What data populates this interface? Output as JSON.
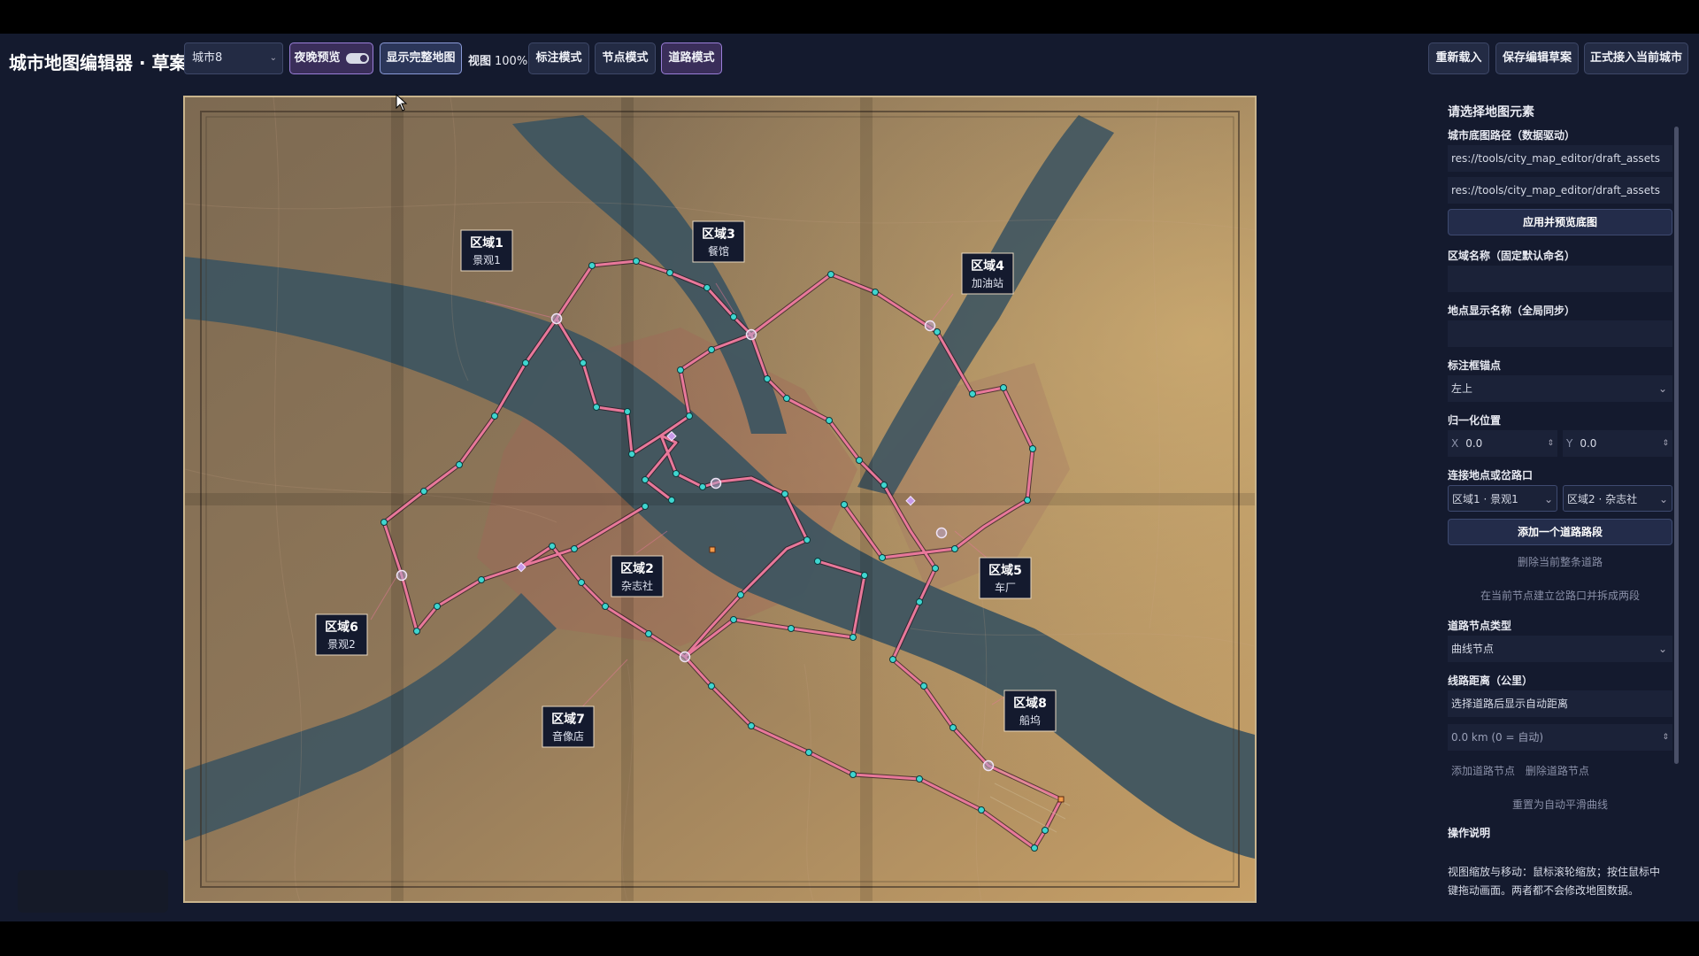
{
  "toolbar": {
    "title": "城市地图编辑器 · 草案",
    "city_select": "城市8",
    "night_preview": "夜晚预览",
    "show_full_map": "显示完整地图",
    "zoom_label": "视图",
    "zoom_value": "100%",
    "label_mode": "标注模式",
    "node_mode": "节点模式",
    "road_mode": "道路模式",
    "reload": "重新载入",
    "save_draft": "保存编辑草案",
    "apply_city": "正式接入当前城市"
  },
  "map": {
    "regions": [
      {
        "title": "区域1",
        "sub": "景观1"
      },
      {
        "title": "区域2",
        "sub": "杂志社"
      },
      {
        "title": "区域3",
        "sub": "餐馆"
      },
      {
        "title": "区域4",
        "sub": "加油站"
      },
      {
        "title": "区域5",
        "sub": "车厂"
      },
      {
        "title": "区域6",
        "sub": "景观2"
      },
      {
        "title": "区域7",
        "sub": "音像店"
      },
      {
        "title": "区域8",
        "sub": "船坞"
      }
    ]
  },
  "panel": {
    "header": "请选择地图元素",
    "basemap_label": "城市底图路径（数据驱动）",
    "basemap_path_1": "res://tools/city_map_editor/draft_assets",
    "basemap_path_2": "res://tools/city_map_editor/draft_assets",
    "apply_basemap": "应用并预览底图",
    "region_name_label": "区域名称（固定默认命名）",
    "place_name_label": "地点显示名称（全局同步）",
    "anchor_label": "标注框锚点",
    "anchor_value": "左上",
    "norm_pos_label": "归一化位置",
    "x_label": "X",
    "x_value": "0.0",
    "y_label": "Y",
    "y_value": "0.0",
    "connect_label": "连接地点或岔路口",
    "connect_from": "区域1 · 景观1",
    "connect_to": "区域2 · 杂志社",
    "add_road": "添加一个道路路段",
    "delete_road": "删除当前整条道路",
    "split_road": "在当前节点建立岔路口并拆成两段",
    "node_type_label": "道路节点类型",
    "node_type_value": "曲线节点",
    "distance_label": "线路距离（公里）",
    "distance_hint": "选择道路后显示自动距离",
    "distance_value": "0.0  km  (0 = 自动)",
    "add_node": "添加道路节点",
    "delete_node": "删除道路节点",
    "reset_curve": "重置为自动平滑曲线",
    "help_label": "操作说明",
    "help_text_1": "视图缩放与移动：鼠标滚轮缩放；按住鼠标中",
    "help_text_2": "键拖动画面。两者都不会修改地图数据。"
  },
  "colors": {
    "road": "#e8789a",
    "node": "#3fd6d0",
    "junction": "#b7a3c8",
    "accent": "#9a7ed8"
  }
}
